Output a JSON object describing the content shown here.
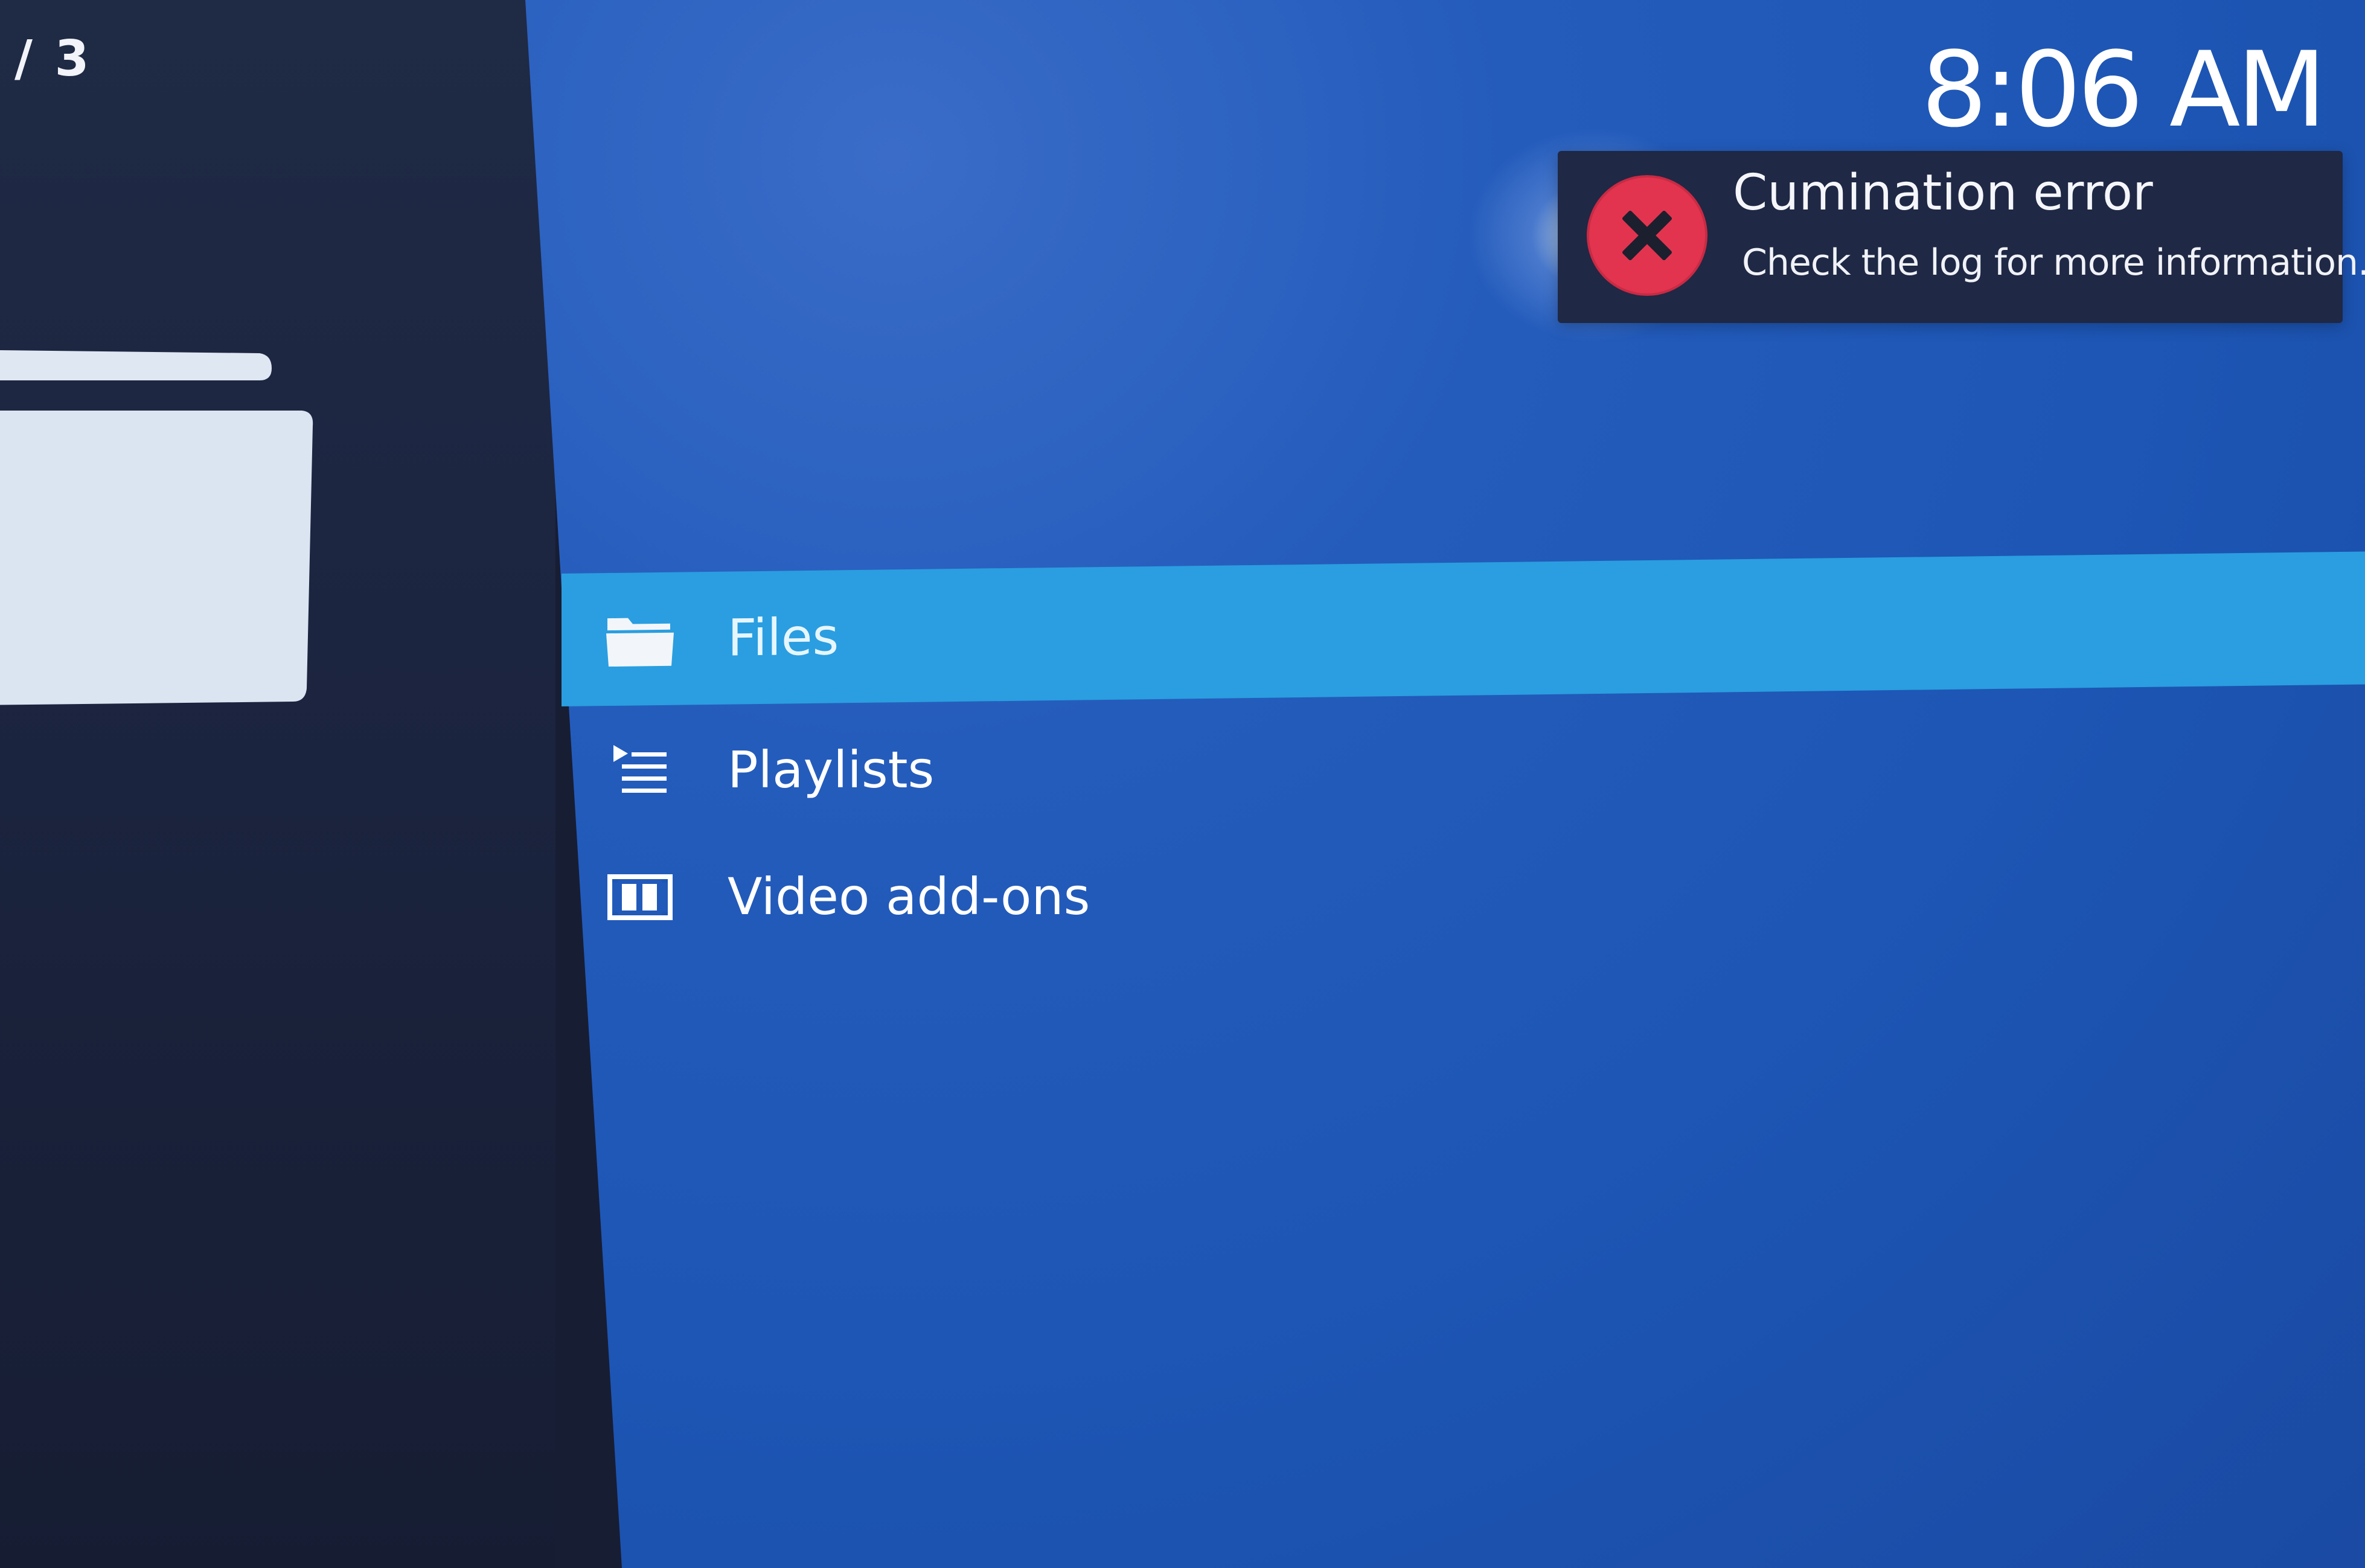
{
  "header": {
    "page_counter": "/ 3",
    "clock": "8:06 AM"
  },
  "notification": {
    "icon": "error-x-icon",
    "title": "Cumination error",
    "message": "Check the log for more information.",
    "icon_color": "#e2344f"
  },
  "menu": {
    "items": [
      {
        "label": "Files",
        "icon": "folder-icon",
        "selected": true
      },
      {
        "label": "Playlists",
        "icon": "playlist-icon",
        "selected": false
      },
      {
        "label": "Video add-ons",
        "icon": "film-strip-icon",
        "selected": false
      }
    ]
  },
  "colors": {
    "selection": "#2a9ee0",
    "background": "#1d56b5",
    "side_panel": "#1c2540"
  }
}
